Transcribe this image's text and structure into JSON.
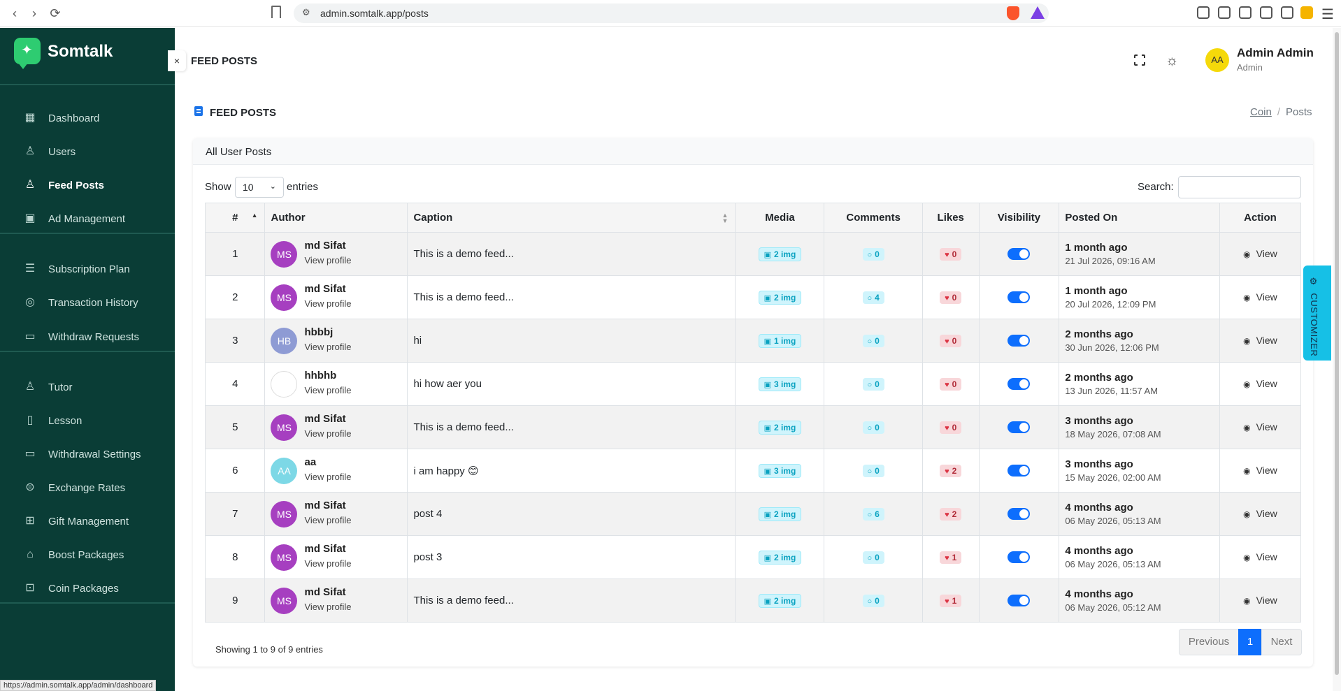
{
  "browser": {
    "url": "admin.somtalk.app/posts",
    "status_url": "https://admin.somtalk.app/admin/dashboard"
  },
  "sidebar": {
    "brand": "Somtalk",
    "items": [
      {
        "label": "Dashboard",
        "icon": "grid-icon"
      },
      {
        "label": "Users",
        "icon": "user-icon"
      },
      {
        "label": "Feed Posts",
        "icon": "user-icon"
      },
      {
        "label": "Ad Management",
        "icon": "image-icon"
      },
      {
        "label": "Subscription Plan",
        "icon": "list-icon"
      },
      {
        "label": "Transaction History",
        "icon": "coins-icon"
      },
      {
        "label": "Withdraw Requests",
        "icon": "card-icon"
      },
      {
        "label": "Tutor",
        "icon": "user-icon"
      },
      {
        "label": "Lesson",
        "icon": "book-icon"
      },
      {
        "label": "Withdrawal Settings",
        "icon": "card-icon"
      },
      {
        "label": "Exchange Rates",
        "icon": "exchange-icon"
      },
      {
        "label": "Gift Management",
        "icon": "gift-icon"
      },
      {
        "label": "Boost Packages",
        "icon": "rocket-icon"
      },
      {
        "label": "Coin Packages",
        "icon": "package-icon"
      }
    ]
  },
  "header": {
    "page_heading": "FEED POSTS",
    "admin_initials": "AA",
    "admin_name": "Admin Admin",
    "admin_role": "Admin"
  },
  "page": {
    "title": "FEED POSTS",
    "breadcrumb_link": "Coin",
    "breadcrumb_sep": "/",
    "breadcrumb_current": "Posts"
  },
  "card": {
    "title": "All User Posts",
    "show_label": "Show",
    "entries_label": "entries",
    "page_length": "10",
    "search_label": "Search:",
    "search_value": "",
    "info": "Showing 1 to 9 of 9 entries",
    "prev_label": "Previous",
    "current_page": "1",
    "next_label": "Next"
  },
  "table": {
    "headers": [
      "#",
      "Author",
      "Caption",
      "Media",
      "Comments",
      "Likes",
      "Visibility",
      "Posted On",
      "Action"
    ],
    "rows": [
      {
        "num": "1",
        "initials": "MS",
        "avatar_color": "#a63fc0",
        "author": "md Sifat",
        "profile": "View profile",
        "caption": "This is a demo feed...",
        "media": "2 img",
        "comments": "0",
        "likes": "0",
        "posted_rel": "1 month ago",
        "posted_abs": "21 Jul 2026, 09:16 AM",
        "action": "View"
      },
      {
        "num": "2",
        "initials": "MS",
        "avatar_color": "#a63fc0",
        "author": "md Sifat",
        "profile": "View profile",
        "caption": "This is a demo feed...",
        "media": "2 img",
        "comments": "4",
        "likes": "0",
        "posted_rel": "1 month ago",
        "posted_abs": "20 Jul 2026, 12:09 PM",
        "action": "View"
      },
      {
        "num": "3",
        "initials": "HB",
        "avatar_color": "#8e9bd4",
        "author": "hbbbj",
        "profile": "View profile",
        "caption": "hi",
        "media": "1 img",
        "comments": "0",
        "likes": "0",
        "posted_rel": "2 months ago",
        "posted_abs": "30 Jun 2026, 12:06 PM",
        "action": "View"
      },
      {
        "num": "4",
        "initials": "",
        "avatar_color": "",
        "author": "hhbhb",
        "profile": "View profile",
        "caption": "hi how aer you",
        "media": "3 img",
        "comments": "0",
        "likes": "0",
        "posted_rel": "2 months ago",
        "posted_abs": "13 Jun 2026, 11:57 AM",
        "action": "View"
      },
      {
        "num": "5",
        "initials": "MS",
        "avatar_color": "#a63fc0",
        "author": "md Sifat",
        "profile": "View profile",
        "caption": "This is a demo feed...",
        "media": "2 img",
        "comments": "0",
        "likes": "0",
        "posted_rel": "3 months ago",
        "posted_abs": "18 May 2026, 07:08 AM",
        "action": "View"
      },
      {
        "num": "6",
        "initials": "AA",
        "avatar_color": "#7dd8e6",
        "author": "aa",
        "profile": "View profile",
        "caption": "i am happy 😊",
        "media": "3 img",
        "comments": "0",
        "likes": "2",
        "posted_rel": "3 months ago",
        "posted_abs": "15 May 2026, 02:00 AM",
        "action": "View"
      },
      {
        "num": "7",
        "initials": "MS",
        "avatar_color": "#a63fc0",
        "author": "md Sifat",
        "profile": "View profile",
        "caption": "post 4",
        "media": "2 img",
        "comments": "6",
        "likes": "2",
        "posted_rel": "4 months ago",
        "posted_abs": "06 May 2026, 05:13 AM",
        "action": "View"
      },
      {
        "num": "8",
        "initials": "MS",
        "avatar_color": "#a63fc0",
        "author": "md Sifat",
        "profile": "View profile",
        "caption": "post 3",
        "media": "2 img",
        "comments": "0",
        "likes": "1",
        "posted_rel": "4 months ago",
        "posted_abs": "06 May 2026, 05:13 AM",
        "action": "View"
      },
      {
        "num": "9",
        "initials": "MS",
        "avatar_color": "#a63fc0",
        "author": "md Sifat",
        "profile": "View profile",
        "caption": "This is a demo feed...",
        "media": "2 img",
        "comments": "0",
        "likes": "1",
        "posted_rel": "4 months ago",
        "posted_abs": "06 May 2026, 05:12 AM",
        "action": "View"
      }
    ]
  },
  "customizer": {
    "label": "CUSTOMIZER"
  },
  "colors": {
    "sidebar_bg": "#0a3d36",
    "brand_green": "#2ecc71",
    "primary": "#0d6efd",
    "info": "#16c0e6",
    "danger": "#b02a37"
  }
}
